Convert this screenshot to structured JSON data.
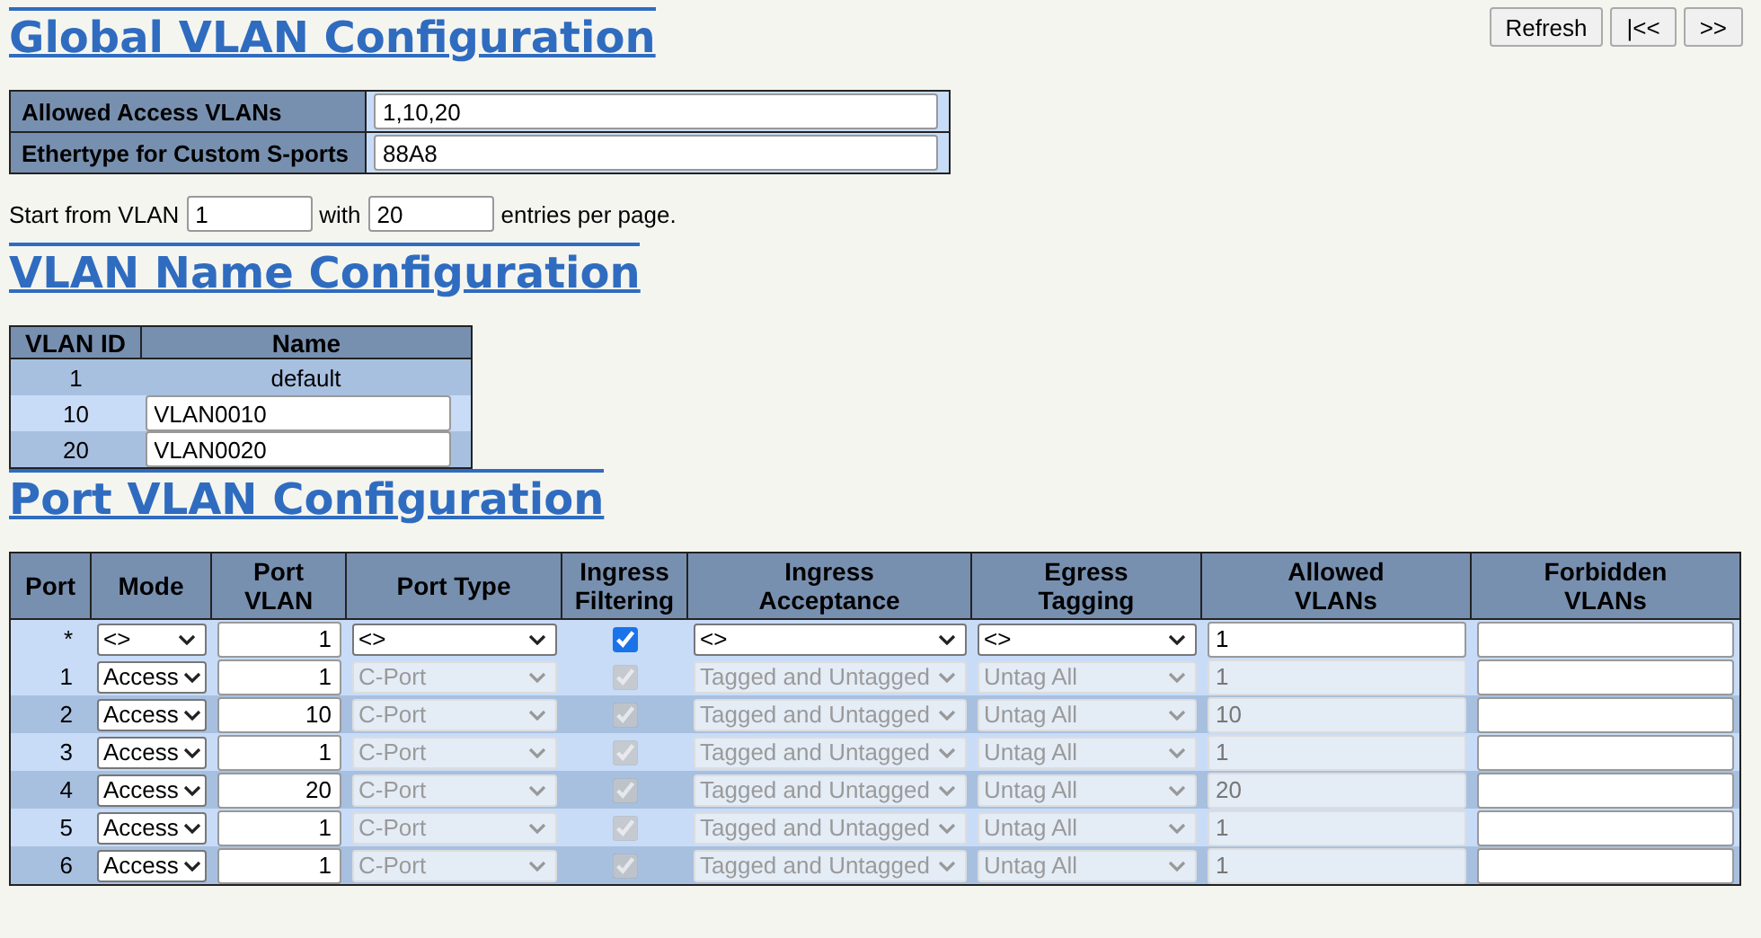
{
  "buttons": [
    {
      "label": "Refresh"
    },
    {
      "label": "|<<"
    },
    {
      "label": ">>"
    }
  ],
  "global": {
    "title": "Global VLAN Configuration",
    "rows": [
      {
        "label": "Allowed Access VLANs",
        "value": "1,10,20"
      },
      {
        "label": "Ethertype for Custom S-ports",
        "value": "88A8"
      }
    ]
  },
  "paging": {
    "prefix": "Start from VLAN",
    "start": "1",
    "middle": "with",
    "count": "20",
    "suffix": "entries per page."
  },
  "vlan_names": {
    "title": "VLAN Name Configuration",
    "columns": [
      "VLAN ID",
      "Name"
    ],
    "rows": [
      {
        "vlan_id": "1",
        "name": "default",
        "editable": false
      },
      {
        "vlan_id": "10",
        "name": "VLAN0010",
        "editable": true
      },
      {
        "vlan_id": "20",
        "name": "VLAN0020",
        "editable": true
      }
    ]
  },
  "port_vlans": {
    "title": "Port VLAN Configuration",
    "columns": [
      "Port",
      "Mode",
      "Port\nVLAN",
      "Port Type",
      "Ingress\nFiltering",
      "Ingress\nAcceptance",
      "Egress\nTagging",
      "Allowed\nVLANs",
      "Forbidden\nVLANs"
    ],
    "rows": [
      {
        "port": "*",
        "mode": "<>",
        "port_vlan": "1",
        "port_type": "<>",
        "ingress_filtering": true,
        "ingress_acceptance": "<>",
        "egress_tagging": "<>",
        "allowed_vlans": "1",
        "disabled": false
      },
      {
        "port": "1",
        "mode": "Access",
        "port_vlan": "1",
        "port_type": "C-Port",
        "ingress_filtering": true,
        "ingress_acceptance": "Tagged and Untagged",
        "egress_tagging": "Untag All",
        "allowed_vlans": "1",
        "disabled": true
      },
      {
        "port": "2",
        "mode": "Access",
        "port_vlan": "10",
        "port_type": "C-Port",
        "ingress_filtering": true,
        "ingress_acceptance": "Tagged and Untagged",
        "egress_tagging": "Untag All",
        "allowed_vlans": "10",
        "disabled": true
      },
      {
        "port": "3",
        "mode": "Access",
        "port_vlan": "1",
        "port_type": "C-Port",
        "ingress_filtering": true,
        "ingress_acceptance": "Tagged and Untagged",
        "egress_tagging": "Untag All",
        "allowed_vlans": "1",
        "disabled": true
      },
      {
        "port": "4",
        "mode": "Access",
        "port_vlan": "20",
        "port_type": "C-Port",
        "ingress_filtering": true,
        "ingress_acceptance": "Tagged and Untagged",
        "egress_tagging": "Untag All",
        "allowed_vlans": "20",
        "disabled": true
      },
      {
        "port": "5",
        "mode": "Access",
        "port_vlan": "1",
        "port_type": "C-Port",
        "ingress_filtering": true,
        "ingress_acceptance": "Tagged and Untagged",
        "egress_tagging": "Untag All",
        "allowed_vlans": "1",
        "disabled": true
      },
      {
        "port": "6",
        "mode": "Access",
        "port_vlan": "1",
        "port_type": "C-Port",
        "ingress_filtering": true,
        "ingress_acceptance": "Tagged and Untagged",
        "egress_tagging": "Untag All",
        "allowed_vlans": "1",
        "disabled": true
      }
    ]
  }
}
